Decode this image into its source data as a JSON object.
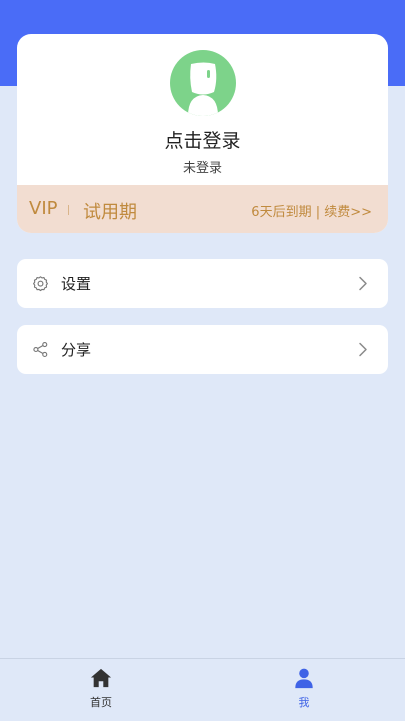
{
  "colors": {
    "header_blue": "#4a6cf7",
    "background": "#dfe8f8",
    "avatar_green": "#7dd38a",
    "vip_bar_bg": "#f2ddd1",
    "vip_gold": "#c08a3e",
    "tab_active": "#3f63e6",
    "tab_inactive": "#333333"
  },
  "profile": {
    "avatar_icon": "user-avatar-icon",
    "login_prompt": "点击登录",
    "status": "未登录"
  },
  "vip": {
    "label": "VIP",
    "plan": "试用期",
    "expiry": "6天后到期 | 续费>>"
  },
  "menu": {
    "items": [
      {
        "label": "设置",
        "icon": "gear-icon"
      },
      {
        "label": "分享",
        "icon": "share-icon"
      }
    ]
  },
  "tabbar": {
    "tabs": [
      {
        "label": "首页",
        "icon": "home-icon",
        "active": false
      },
      {
        "label": "我",
        "icon": "person-icon",
        "active": true
      }
    ]
  }
}
